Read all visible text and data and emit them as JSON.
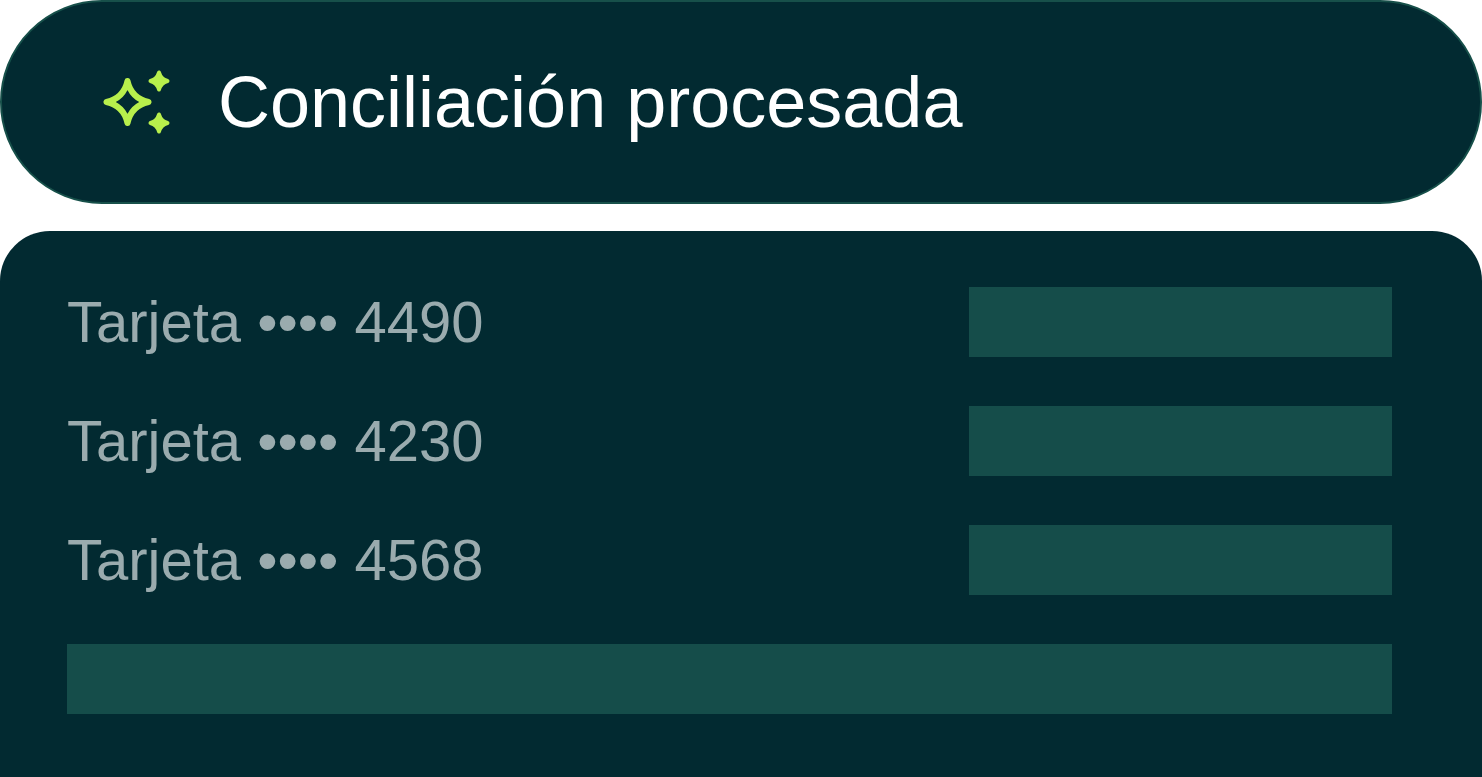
{
  "banner": {
    "title": "Conciliación procesada"
  },
  "card_rows": [
    {
      "label": "Tarjeta •••• 4490"
    },
    {
      "label": "Tarjeta •••• 4230"
    },
    {
      "label": "Tarjeta •••• 4568"
    }
  ]
}
